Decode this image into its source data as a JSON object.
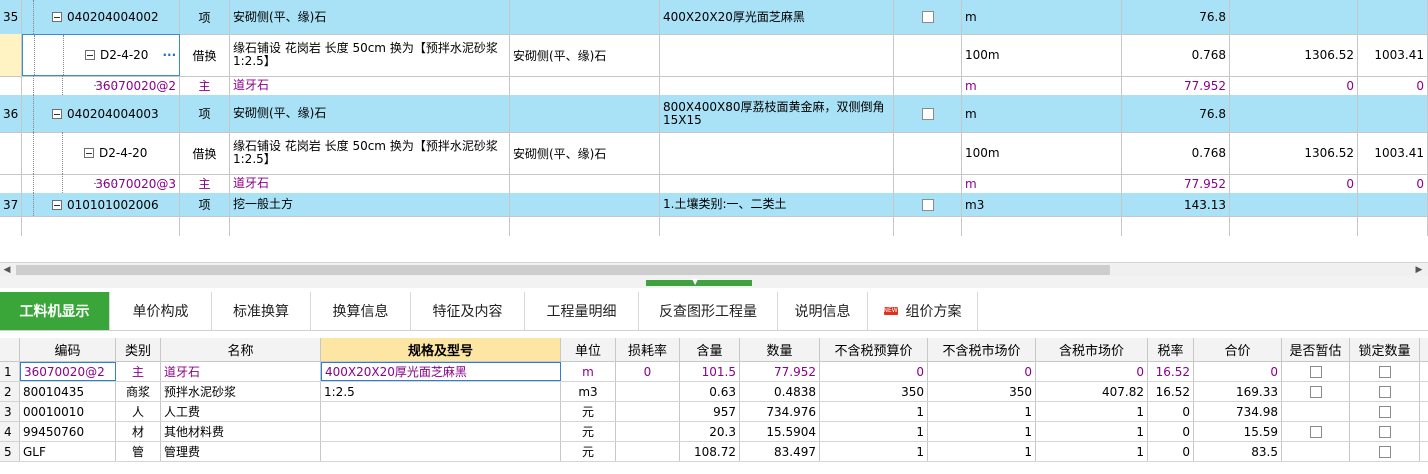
{
  "upper_rows": [
    {
      "num": "35",
      "code": "040204004002",
      "type": "项",
      "name": "安砌侧(平、缘)石",
      "spec": "",
      "features": "400X20X20厚光面芝麻黑",
      "unit": "m",
      "qty": "76.8",
      "price": "",
      "total": "",
      "expand": true,
      "style": "item"
    },
    {
      "num": "",
      "code": "D2-4-20",
      "more": "···",
      "type": "借换",
      "name": "缘石铺设 花岗岩 长度 50cm  换为【预拌水泥砂浆1:2.5】",
      "spec": "安砌侧(平、缘)石",
      "features": "",
      "unit": "100m",
      "qty": "0.768",
      "price": "1306.52",
      "total": "1003.41",
      "expand": true,
      "style": "sub-selected"
    },
    {
      "num": "",
      "code": "36070020@2",
      "type": "主",
      "name": "道牙石",
      "spec": "",
      "features": "",
      "unit": "m",
      "qty": "77.952",
      "price": "0",
      "total": "0",
      "expand": false,
      "style": "material"
    },
    {
      "num": "36",
      "code": "040204004003",
      "type": "项",
      "name": "安砌侧(平、缘)石",
      "spec": "",
      "features": "800X400X80厚荔枝面黄金麻，双侧倒角15X15",
      "unit": "m",
      "qty": "76.8",
      "price": "",
      "total": "",
      "expand": true,
      "style": "item"
    },
    {
      "num": "",
      "code": "D2-4-20",
      "type": "借换",
      "name": "缘石铺设 花岗岩 长度 50cm  换为【预拌水泥砂浆1:2.5】",
      "spec": "安砌侧(平、缘)石",
      "features": "",
      "unit": "100m",
      "qty": "0.768",
      "price": "1306.52",
      "total": "1003.41",
      "expand": true,
      "style": "sub"
    },
    {
      "num": "",
      "code": "36070020@3",
      "type": "主",
      "name": "道牙石",
      "spec": "",
      "features": "",
      "unit": "m",
      "qty": "77.952",
      "price": "0",
      "total": "0",
      "expand": false,
      "style": "material"
    },
    {
      "num": "37",
      "code": "010101002006",
      "type": "项",
      "name": "挖一般土方",
      "spec": "",
      "features": "1.土壤类别:一、二类土",
      "unit": "m3",
      "qty": "143.13",
      "price": "",
      "total": "",
      "expand": true,
      "style": "item"
    }
  ],
  "tabs": [
    {
      "label": "工料机显示",
      "active": true
    },
    {
      "label": "单价构成"
    },
    {
      "label": "标准换算"
    },
    {
      "label": "换算信息"
    },
    {
      "label": "特征及内容"
    },
    {
      "label": "工程量明细"
    },
    {
      "label": "反查图形工程量"
    },
    {
      "label": "说明信息"
    },
    {
      "label": "组价方案",
      "badge": "NEW"
    }
  ],
  "lower_headers": [
    "编码",
    "类别",
    "名称",
    "规格及型号",
    "单位",
    "损耗率",
    "含量",
    "数量",
    "不含税预算价",
    "不含税市场价",
    "含税市场价",
    "税率",
    "合价",
    "是否暂估",
    "锁定数量"
  ],
  "lower_rows": [
    {
      "idx": "1",
      "code": "36070020@2",
      "type": "主",
      "name": "道牙石",
      "spec": "400X20X20厚光面芝麻黑",
      "unit": "m",
      "loss": "0",
      "content": "101.5",
      "qty": "77.952",
      "budget": "0",
      "market": "0",
      "tax_market": "0",
      "rate": "16.52",
      "total": "0",
      "est": true,
      "lock": true,
      "purple": true
    },
    {
      "idx": "2",
      "code": "80010435",
      "type": "商浆",
      "name": "预拌水泥砂浆",
      "spec": "1:2.5",
      "unit": "m3",
      "loss": "",
      "content": "0.63",
      "qty": "0.4838",
      "budget": "350",
      "market": "350",
      "tax_market": "407.82",
      "rate": "16.52",
      "total": "169.33",
      "est": true,
      "lock": true
    },
    {
      "idx": "3",
      "code": "00010010",
      "type": "人",
      "name": "人工费",
      "spec": "",
      "unit": "元",
      "loss": "",
      "content": "957",
      "qty": "734.976",
      "budget": "1",
      "market": "1",
      "tax_market": "1",
      "rate": "0",
      "total": "734.98",
      "est": false,
      "lock": true
    },
    {
      "idx": "4",
      "code": "99450760",
      "type": "材",
      "name": "其他材料费",
      "spec": "",
      "unit": "元",
      "loss": "",
      "content": "20.3",
      "qty": "15.5904",
      "budget": "1",
      "market": "1",
      "tax_market": "1",
      "rate": "0",
      "total": "15.59",
      "est": true,
      "lock": true
    },
    {
      "idx": "5",
      "code": "GLF",
      "type": "管",
      "name": "管理费",
      "spec": "",
      "unit": "元",
      "loss": "",
      "content": "108.72",
      "qty": "83.497",
      "budget": "1",
      "market": "1",
      "tax_market": "1",
      "rate": "0",
      "total": "83.5",
      "est": false,
      "lock": true
    }
  ],
  "colors": {
    "item_row": "#a9e2f6",
    "material_text": "#8b008b",
    "active_tab": "#3aa63a",
    "spec_header": "#fde6a4"
  }
}
